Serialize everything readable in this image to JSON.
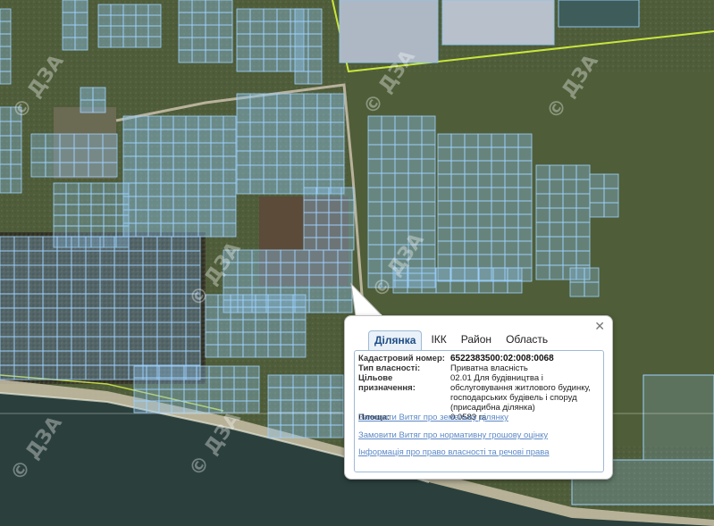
{
  "watermark": "© ДЗА",
  "popup": {
    "close_glyph": "✕",
    "tabs": [
      {
        "label": "Ділянка",
        "active": true
      },
      {
        "label": "ІКК",
        "active": false
      },
      {
        "label": "Район",
        "active": false
      },
      {
        "label": "Область",
        "active": false
      }
    ],
    "fields": [
      {
        "label": "Кадастровий номер:",
        "value": "6522383500:02:008:0068"
      },
      {
        "label": "Тип власності:",
        "value": "Приватна власність"
      },
      {
        "label": "Цільове призначення:",
        "value": "02.01 Для будівництва і обслуговування житлового будинку, господарських будівель і споруд (присадибна ділянка)"
      },
      {
        "label": "Площа:",
        "value": "0.0583 га"
      }
    ],
    "links": [
      "Замовити Витяг про земельну ділянку",
      "Замовити Витяг про нормативну грошову оцінку",
      "Інформація про право власності та речові права"
    ]
  },
  "colors": {
    "parcel_fill": "#8fc3ea",
    "parcel_stroke": "#9fd3ff",
    "boundary_line": "#c8e63c",
    "sea": "#2a3f3c",
    "field": "#4b5a36"
  }
}
